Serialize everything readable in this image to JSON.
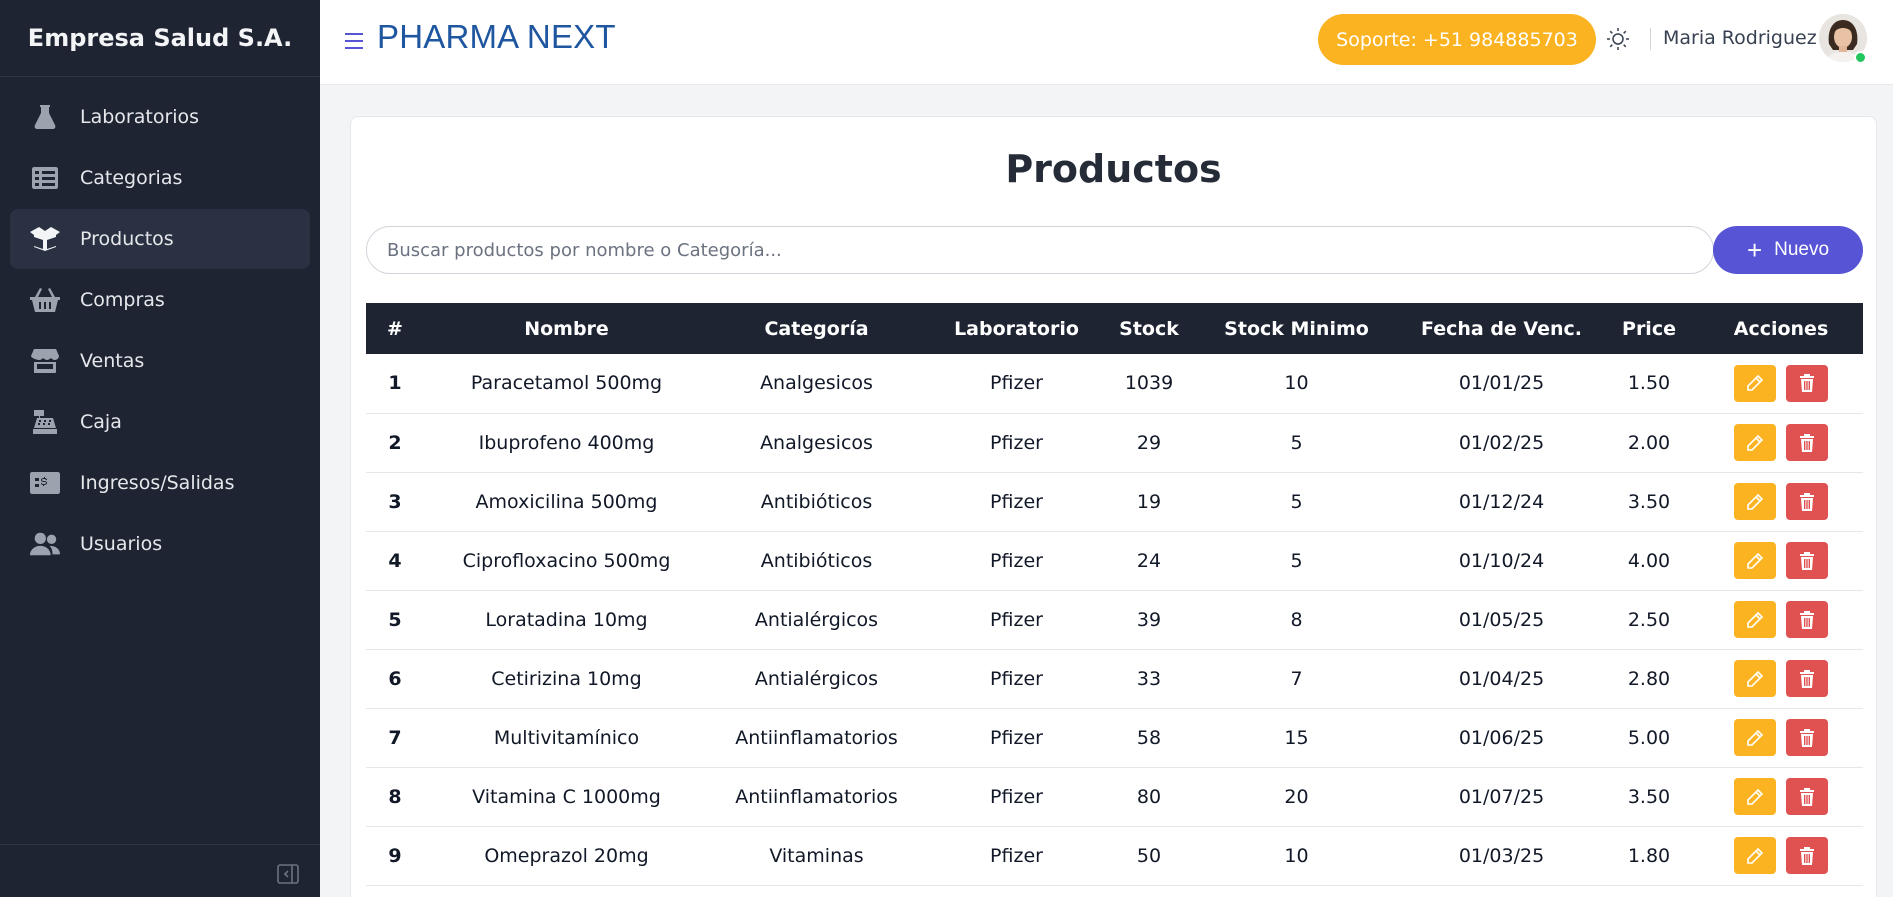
{
  "sidebar": {
    "brand": "Empresa Salud S.A.",
    "items": [
      {
        "label": "Laboratorios",
        "icon": "flask-icon"
      },
      {
        "label": "Categorias",
        "icon": "list-icon"
      },
      {
        "label": "Productos",
        "icon": "box-open-icon",
        "active": true
      },
      {
        "label": "Compras",
        "icon": "basket-icon"
      },
      {
        "label": "Ventas",
        "icon": "store-icon"
      },
      {
        "label": "Caja",
        "icon": "cash-register-icon"
      },
      {
        "label": "Ingresos/Salidas",
        "icon": "money-bill-icon"
      },
      {
        "label": "Usuarios",
        "icon": "users-icon"
      }
    ]
  },
  "header": {
    "title": "PHARMA NEXT",
    "support": "Soporte: +51 984885703",
    "user": "Maria Rodriguez"
  },
  "main": {
    "title": "Productos",
    "search_placeholder": "Buscar productos por nombre o Categoría...",
    "new_label": "Nuevo",
    "columns": [
      "#",
      "Nombre",
      "Categoría",
      "Laboratorio",
      "Stock",
      "Stock Minimo",
      "Fecha de Venc.",
      "Price",
      "Acciones"
    ],
    "rows": [
      [
        "1",
        "Paracetamol 500mg",
        "Analgesicos",
        "Pfizer",
        "1039",
        "10",
        "01/01/25",
        "1.50"
      ],
      [
        "2",
        "Ibuprofeno 400mg",
        "Analgesicos",
        "Pfizer",
        "29",
        "5",
        "01/02/25",
        "2.00"
      ],
      [
        "3",
        "Amoxicilina 500mg",
        "Antibióticos",
        "Pfizer",
        "19",
        "5",
        "01/12/24",
        "3.50"
      ],
      [
        "4",
        "Ciprofloxacino 500mg",
        "Antibióticos",
        "Pfizer",
        "24",
        "5",
        "01/10/24",
        "4.00"
      ],
      [
        "5",
        "Loratadina 10mg",
        "Antialérgicos",
        "Pfizer",
        "39",
        "8",
        "01/05/25",
        "2.50"
      ],
      [
        "6",
        "Cetirizina 10mg",
        "Antialérgicos",
        "Pfizer",
        "33",
        "7",
        "01/04/25",
        "2.80"
      ],
      [
        "7",
        "Multivitamínico",
        "Antiinflamatorios",
        "Pfizer",
        "58",
        "15",
        "01/06/25",
        "5.00"
      ],
      [
        "8",
        "Vitamina C 1000mg",
        "Antiinflamatorios",
        "Pfizer",
        "80",
        "20",
        "01/07/25",
        "3.50"
      ],
      [
        "9",
        "Omeprazol 20mg",
        "Vitaminas",
        "Pfizer",
        "50",
        "10",
        "01/03/25",
        "1.80"
      ]
    ]
  },
  "colors": {
    "sidebar_bg": "#1f2433",
    "brand_blue": "#1e56a0",
    "support_bg": "#fbb321",
    "primary": "#5754d6",
    "edit": "#fbb321",
    "delete": "#e05252"
  }
}
